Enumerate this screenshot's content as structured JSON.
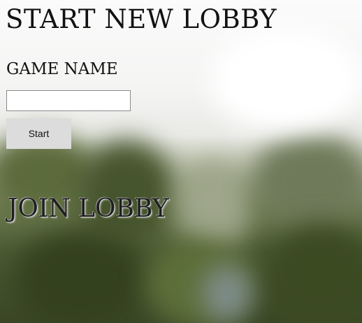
{
  "start_lobby": {
    "title": "START NEW LOBBY",
    "game_name_label": "GAME NAME",
    "game_name_value": "",
    "start_button_label": "Start"
  },
  "join_lobby": {
    "title": "JOIN LOBBY"
  }
}
